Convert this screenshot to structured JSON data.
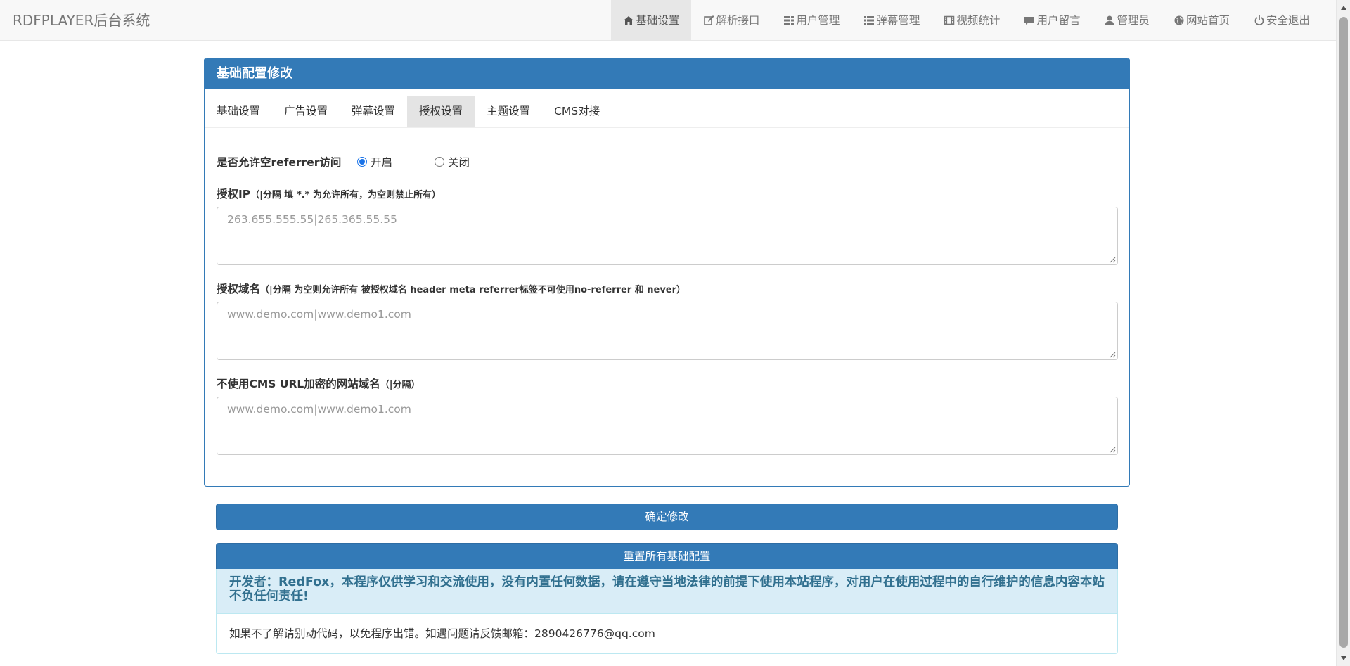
{
  "app": {
    "brand": "RDFPLAYER后台系统"
  },
  "nav": [
    {
      "label": "基础设置",
      "icon": "home-icon",
      "active": true
    },
    {
      "label": "解析接口",
      "icon": "edit-icon"
    },
    {
      "label": "用户管理",
      "icon": "grid-icon"
    },
    {
      "label": "弹幕管理",
      "icon": "list-icon"
    },
    {
      "label": "视频统计",
      "icon": "film-icon"
    },
    {
      "label": "用户留言",
      "icon": "comment-icon"
    },
    {
      "label": "管理员",
      "icon": "user-icon"
    },
    {
      "label": "网站首页",
      "icon": "globe-icon"
    },
    {
      "label": "安全退出",
      "icon": "power-icon"
    }
  ],
  "panel": {
    "title": "基础配置修改",
    "tabs": [
      {
        "label": "基础设置"
      },
      {
        "label": "广告设置"
      },
      {
        "label": "弹幕设置"
      },
      {
        "label": "授权设置",
        "active": true
      },
      {
        "label": "主题设置"
      },
      {
        "label": "CMS对接"
      }
    ]
  },
  "form": {
    "referrer": {
      "label": "是否允许空referrer访问",
      "options": [
        "开启",
        "关闭"
      ],
      "selected": "开启"
    },
    "auth_ip": {
      "label": "授权IP",
      "hint": "（|分隔 填 *.* 为允许所有，为空则禁止所有）",
      "placeholder": "263.655.555.55|265.365.55.55",
      "value": ""
    },
    "auth_domain": {
      "label": "授权域名",
      "hint": "（|分隔 为空则允许所有 被授权域名 header meta referrer标签不可使用no-referrer 和 never）",
      "placeholder": "www.demo.com|www.demo1.com",
      "value": ""
    },
    "no_encrypt_domain": {
      "label": "不使用CMS URL加密的网站域名",
      "hint": "（|分隔）",
      "placeholder": "www.demo.com|www.demo1.com",
      "value": ""
    }
  },
  "buttons": {
    "confirm": "确定修改",
    "reset": "重置所有基础配置"
  },
  "footer": {
    "disclaimer": "开发者：RedFox，本程序仅供学习和交流使用，没有内置任何数据，请在遵守当地法律的前提下使用本站程序，对用户在使用过程中的自行维护的信息内容本站不负任何责任!",
    "note": "如果不了解请别动代码，以免程序出错。如遇问题请反馈邮箱：2890426776@qq.com"
  }
}
